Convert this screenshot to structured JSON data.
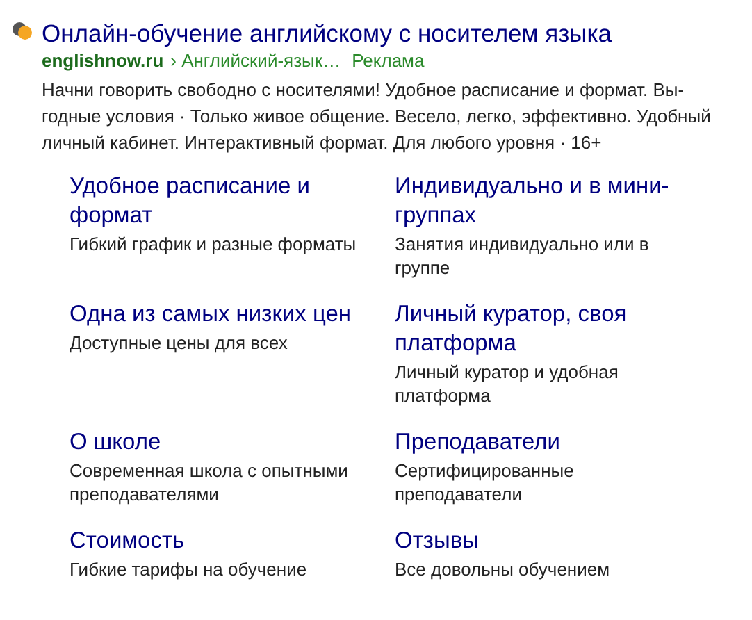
{
  "ad": {
    "title": "Онлайн-обучение английскому с носителем языка",
    "domain": "englishnow.ru",
    "path": "› Английский-язык…",
    "label": "Реклама",
    "description": "Начни говорить свободно с носителями! Удобное расписание и формат. Вы-годные условия · Только живое общение. Весело, легко, эффективно. Удобный личный кабинет. Интерактивный формат. Для любого уровня · 16+"
  },
  "sitelinks": [
    {
      "title": "Удобное расписание и формат",
      "description": "Гибкий график и разные форматы"
    },
    {
      "title": "Индивидуально и в мини-группах",
      "description": "Занятия индивидуально или в группе"
    },
    {
      "title": "Одна из самых низких цен",
      "description": "Доступные цены для всех"
    },
    {
      "title": "Личный куратор, своя платформа",
      "description": "Личный куратор и удобная платформа"
    },
    {
      "title": "О школе",
      "description": "Современная школа с опытными преподавателями"
    },
    {
      "title": "Преподаватели",
      "description": "Сертифицированные преподаватели"
    },
    {
      "title": "Стоимость",
      "description": "Гибкие тарифы на обучение"
    },
    {
      "title": "Отзывы",
      "description": "Все довольны обучением"
    }
  ]
}
